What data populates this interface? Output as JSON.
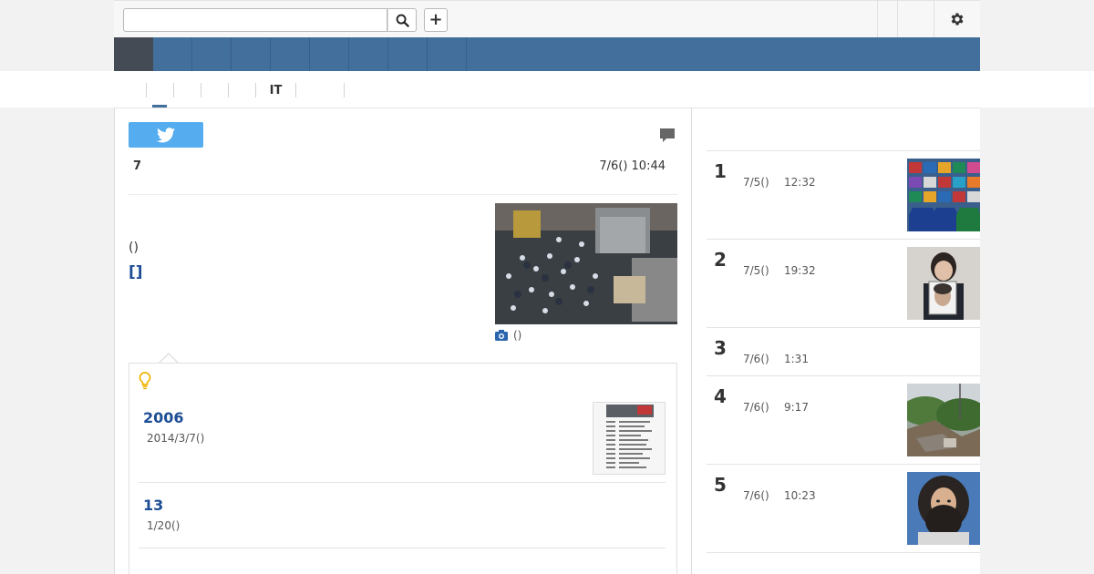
{
  "header": {
    "search": {
      "value": "",
      "placeholder": ""
    },
    "search_button_icon": "search-icon",
    "add_button_label": "+",
    "settings_icon": "gear-icon"
  },
  "nav": {
    "item_count": 9,
    "active_index": 0
  },
  "subnav": {
    "items": [
      "",
      "",
      "",
      "",
      "",
      "IT",
      "",
      ""
    ],
    "active_index": 0
  },
  "article": {
    "share_icon": "twitter-icon",
    "comment_icon": "comment-icon",
    "source": "7",
    "datetime": "7/6() 10:44",
    "body_text": "()",
    "link_text": "[]",
    "photo_caption": "()"
  },
  "related": {
    "icon": "lightbulb-icon",
    "items": [
      {
        "title": "2006",
        "date": "2014/3/7()"
      },
      {
        "title": "13",
        "date": "1/20()"
      }
    ]
  },
  "ranking": {
    "items": [
      {
        "rank": "1",
        "date": "7/5()",
        "time": "12:32"
      },
      {
        "rank": "2",
        "date": "7/5()",
        "time": "19:32"
      },
      {
        "rank": "3",
        "date": "7/6()",
        "time": "1:31"
      },
      {
        "rank": "4",
        "date": "7/6()",
        "time": "9:17"
      },
      {
        "rank": "5",
        "date": "7/6()",
        "time": "10:23"
      }
    ]
  },
  "colors": {
    "nav_blue": "#426f9b",
    "nav_active": "#454b55",
    "link_blue": "#1d4d96",
    "twitter": "#55acee",
    "bulb": "#f0b400"
  }
}
